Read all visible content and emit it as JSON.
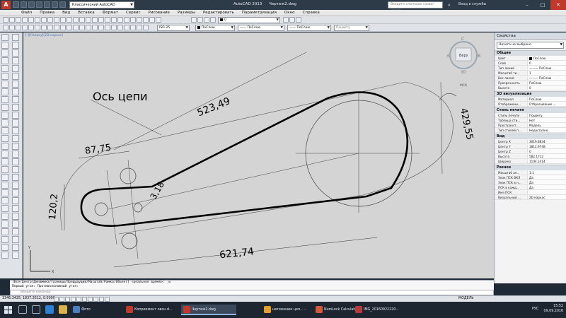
{
  "window": {
    "app_logo": "A",
    "workspace": "Классический AutoCAD",
    "app_name": "AutoCAD 2013",
    "file_name": "Чертеж2.dwg",
    "search_placeholder": "Введите ключевое слово/фразу",
    "signin": "Вход в службы"
  },
  "menu": [
    "Файл",
    "Правка",
    "Вид",
    "Вставка",
    "Формат",
    "Сервис",
    "Рисование",
    "Размеры",
    "Редактировать",
    "Параметризация",
    "Окно",
    "Справка"
  ],
  "toolbar": {
    "dimstyle": "ISO-25",
    "layer": "ПоСлою",
    "linetype": "ПоСлою",
    "lineweight": "ПоСлою",
    "plotstyle": "Поцвету"
  },
  "drawing": {
    "view_label": "[-][Сверху][2D-каркас]",
    "label_chain_axis": "Ось цепи",
    "dim_523": "523,49",
    "dim_429": "429,55",
    "dim_621": "621,74",
    "dim_87": "87,75",
    "dim_120": "120,2",
    "dim_3": "3,18",
    "viewcube_top": "Верх",
    "viewcube_north": "С",
    "viewcube_south": "Ю",
    "viewcube_west": "З",
    "viewcube_east": "В",
    "ucs_label": "МСК"
  },
  "properties": {
    "title": "Свойства",
    "selection": "Ничего не выбрано",
    "sections": [
      {
        "name": "Общие",
        "rows": [
          {
            "k": "Цвет",
            "v": "ПоСлою",
            "swatch": true
          },
          {
            "k": "Слой",
            "v": "0"
          },
          {
            "k": "Тип линий",
            "v": "——— ПоСлою"
          },
          {
            "k": "Масштаб ти...",
            "v": "1"
          },
          {
            "k": "Вес линий",
            "v": "——— ПоСлою"
          },
          {
            "k": "Прозрачность",
            "v": "ПоСлою"
          },
          {
            "k": "Высота",
            "v": "0"
          }
        ]
      },
      {
        "name": "3D визуализация",
        "rows": [
          {
            "k": "Материал",
            "v": "ПоСлою"
          },
          {
            "k": "Отображени...",
            "v": "Отбрасывание ..."
          }
        ]
      },
      {
        "name": "Стиль печати",
        "rows": [
          {
            "k": "Стиль печати",
            "v": "Поцвету"
          },
          {
            "k": "Таблица сти...",
            "v": "Нет"
          },
          {
            "k": "Пространст...",
            "v": "Модель"
          },
          {
            "k": "Тип стилей п...",
            "v": "Недоступно"
          }
        ]
      },
      {
        "name": "Вид",
        "rows": [
          {
            "k": "Центр X",
            "v": "3019.8834"
          },
          {
            "k": "Центр Y",
            "v": "1812.9748"
          },
          {
            "k": "Центр Z",
            "v": "0"
          },
          {
            "k": "Высота",
            "v": "582.1712"
          },
          {
            "k": "Ширина",
            "v": "1104.1414"
          }
        ]
      },
      {
        "name": "Разное",
        "rows": [
          {
            "k": "Масштаб ан...",
            "v": "1:1"
          },
          {
            "k": "Знак ПСК ВКЛ",
            "v": "Да"
          },
          {
            "k": "Знак ПСК в н...",
            "v": "Да"
          },
          {
            "k": "ПСК в кажд...",
            "v": "Да"
          },
          {
            "k": "Имя ПСК",
            "v": ""
          },
          {
            "k": "Визуальный ...",
            "v": "2D каркас"
          }
        ]
      }
    ]
  },
  "command": {
    "line1": "[Все/Центр/Динамика/Границы/Предыдущий/Масштаб/Рамка/Объект] <реальное время>: _w",
    "line2": "Первый угол: Противоположный угол:",
    "input_placeholder": "Введите команду"
  },
  "status": {
    "coords": "3346.3425, 1837.3512, 0.0000",
    "model": "МОДЕЛЬ"
  },
  "taskbar": {
    "tasks": [
      "Фото",
      "Коприемонт овон.d...",
      "Чертеж2.dwg",
      "натяжение цеп... -",
      "NumLock Calculator",
      "IMG_20160922220..."
    ],
    "lang": "РУС",
    "time": "15:52",
    "date": "09.09.2016"
  }
}
